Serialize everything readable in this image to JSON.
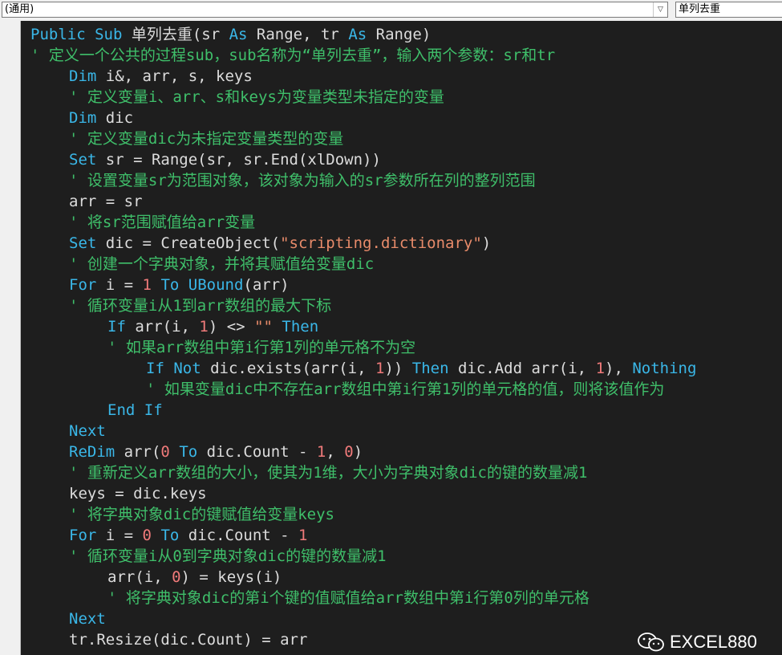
{
  "toolbar": {
    "object_combo_value": "(通用)",
    "procedure_combo_value": "单列去重",
    "dropdown_glyph": "▽"
  },
  "code_lines": [
    {
      "indent": 0,
      "tokens": [
        [
          "kw",
          "Public Sub"
        ],
        [
          "idt",
          " 单列去重(sr "
        ],
        [
          "kw",
          "As"
        ],
        [
          "idt",
          " Range, tr "
        ],
        [
          "kw",
          "As"
        ],
        [
          "idt",
          " Range)"
        ]
      ]
    },
    {
      "indent": 0,
      "tokens": [
        [
          "cmt",
          "' 定义一个公共的过程sub，sub名称为“单列去重”，输入两个参数：sr和tr"
        ]
      ]
    },
    {
      "indent": 1,
      "tokens": [
        [
          "kw",
          "Dim"
        ],
        [
          "idt",
          " i&, arr, s, keys"
        ]
      ]
    },
    {
      "indent": 1,
      "tokens": [
        [
          "cmt",
          "' 定义变量i、arr、s和keys为变量类型未指定的变量"
        ]
      ]
    },
    {
      "indent": 1,
      "tokens": [
        [
          "kw",
          "Dim"
        ],
        [
          "idt",
          " dic"
        ]
      ]
    },
    {
      "indent": 1,
      "tokens": [
        [
          "cmt",
          "' 定义变量dic为未指定变量类型的变量"
        ]
      ]
    },
    {
      "indent": 1,
      "tokens": [
        [
          "kw",
          "Set"
        ],
        [
          "idt",
          " sr = Range(sr, sr.End(xlDown))"
        ]
      ]
    },
    {
      "indent": 1,
      "tokens": [
        [
          "cmt",
          "' 设置变量sr为范围对象，该对象为输入的sr参数所在列的整列范围"
        ]
      ]
    },
    {
      "indent": 1,
      "tokens": [
        [
          "idt",
          "arr = sr"
        ]
      ]
    },
    {
      "indent": 1,
      "tokens": [
        [
          "cmt",
          "' 将sr范围赋值给arr变量"
        ]
      ]
    },
    {
      "indent": 1,
      "tokens": [
        [
          "kw",
          "Set"
        ],
        [
          "idt",
          " dic = CreateObject("
        ],
        [
          "str",
          "\"scripting.dictionary\""
        ],
        [
          "idt",
          ")"
        ]
      ]
    },
    {
      "indent": 1,
      "tokens": [
        [
          "cmt",
          "' 创建一个字典对象，并将其赋值给变量dic"
        ]
      ]
    },
    {
      "indent": 1,
      "tokens": [
        [
          "kw",
          "For"
        ],
        [
          "idt",
          " i = "
        ],
        [
          "num",
          "1"
        ],
        [
          "idt",
          " "
        ],
        [
          "kw",
          "To"
        ],
        [
          "idt",
          " "
        ],
        [
          "kw",
          "UBound"
        ],
        [
          "idt",
          "(arr)"
        ]
      ]
    },
    {
      "indent": 1,
      "tokens": [
        [
          "cmt",
          "' 循环变量i从1到arr数组的最大下标"
        ]
      ]
    },
    {
      "indent": 2,
      "tokens": [
        [
          "kw",
          "If"
        ],
        [
          "idt",
          " arr(i, "
        ],
        [
          "num",
          "1"
        ],
        [
          "idt",
          ") <> "
        ],
        [
          "str",
          "\"\""
        ],
        [
          "idt",
          " "
        ],
        [
          "kw",
          "Then"
        ]
      ]
    },
    {
      "indent": 2,
      "tokens": [
        [
          "cmt",
          "' 如果arr数组中第i行第1列的单元格不为空"
        ]
      ]
    },
    {
      "indent": 3,
      "tokens": [
        [
          "kw",
          "If Not"
        ],
        [
          "idt",
          " dic.exists(arr(i, "
        ],
        [
          "num",
          "1"
        ],
        [
          "idt",
          ")) "
        ],
        [
          "kw",
          "Then"
        ],
        [
          "idt",
          " dic.Add arr(i, "
        ],
        [
          "num",
          "1"
        ],
        [
          "idt",
          "), "
        ],
        [
          "kw",
          "Nothing"
        ]
      ]
    },
    {
      "indent": 3,
      "tokens": [
        [
          "cmt",
          "' 如果变量dic中不存在arr数组中第i行第1列的单元格的值，则将该值作为"
        ]
      ]
    },
    {
      "indent": 2,
      "tokens": [
        [
          "kw",
          "End If"
        ]
      ]
    },
    {
      "indent": 1,
      "tokens": [
        [
          "kw",
          "Next"
        ]
      ]
    },
    {
      "indent": 1,
      "tokens": [
        [
          "kw",
          "ReDim"
        ],
        [
          "idt",
          " arr("
        ],
        [
          "num",
          "0"
        ],
        [
          "idt",
          " "
        ],
        [
          "kw",
          "To"
        ],
        [
          "idt",
          " dic.Count - "
        ],
        [
          "num",
          "1"
        ],
        [
          "idt",
          ", "
        ],
        [
          "num",
          "0"
        ],
        [
          "idt",
          ")"
        ]
      ]
    },
    {
      "indent": 1,
      "tokens": [
        [
          "cmt",
          "' 重新定义arr数组的大小，使其为1维，大小为字典对象dic的键的数量减1"
        ]
      ]
    },
    {
      "indent": 1,
      "tokens": [
        [
          "idt",
          "keys = dic.keys"
        ]
      ]
    },
    {
      "indent": 1,
      "tokens": [
        [
          "cmt",
          "' 将字典对象dic的键赋值给变量keys"
        ]
      ]
    },
    {
      "indent": 1,
      "tokens": [
        [
          "kw",
          "For"
        ],
        [
          "idt",
          " i = "
        ],
        [
          "num",
          "0"
        ],
        [
          "idt",
          " "
        ],
        [
          "kw",
          "To"
        ],
        [
          "idt",
          " dic.Count - "
        ],
        [
          "num",
          "1"
        ]
      ]
    },
    {
      "indent": 1,
      "tokens": [
        [
          "cmt",
          "' 循环变量i从0到字典对象dic的键的数量减1"
        ]
      ]
    },
    {
      "indent": 2,
      "tokens": [
        [
          "idt",
          "arr(i, "
        ],
        [
          "num",
          "0"
        ],
        [
          "idt",
          ") = keys(i)"
        ]
      ]
    },
    {
      "indent": 2,
      "tokens": [
        [
          "cmt",
          "' 将字典对象dic的第i个键的值赋值给arr数组中第i行第0列的单元格"
        ]
      ]
    },
    {
      "indent": 1,
      "tokens": [
        [
          "kw",
          "Next"
        ]
      ]
    },
    {
      "indent": 1,
      "tokens": [
        [
          "idt",
          "tr.Resize(dic.Count) = arr"
        ]
      ]
    }
  ],
  "colors": {
    "editor_bg": "#1e1e1e",
    "keyword": "#3ab7e8",
    "comment": "#3fbf6a",
    "string": "#e88b6a",
    "number": "#f07a7a",
    "identifier": "#dcdcdc"
  },
  "watermark": {
    "icon": "wechat-icon",
    "text": "EXCEL880"
  }
}
